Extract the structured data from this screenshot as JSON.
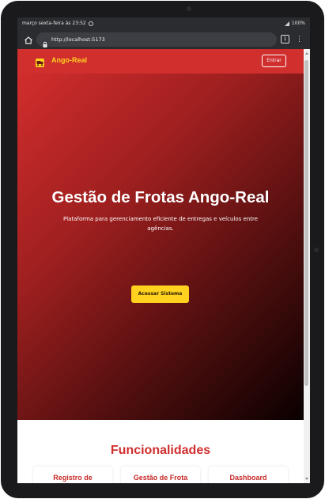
{
  "status_bar": {
    "datetime": "março sexta-feira às 23:52",
    "battery": "100%"
  },
  "browser": {
    "url": "http://localhost:5173",
    "tab_count": "1"
  },
  "navbar": {
    "brand": "Ango-Real",
    "login_label": "Entrar"
  },
  "hero": {
    "title": "Gestão de Frotas Ango-Real",
    "subtitle": "Plataforma para gerenciamento eficiente de entregas e veículos entre agências.",
    "cta_label": "Acessar Sistema"
  },
  "features": {
    "title": "Funcionalidades",
    "cards": [
      {
        "title": "Registro de"
      },
      {
        "title": "Gestão de Frota"
      },
      {
        "title": "Dashboard"
      }
    ]
  },
  "colors": {
    "brand_red": "#d12e2e",
    "brand_yellow": "#ffd21f"
  }
}
